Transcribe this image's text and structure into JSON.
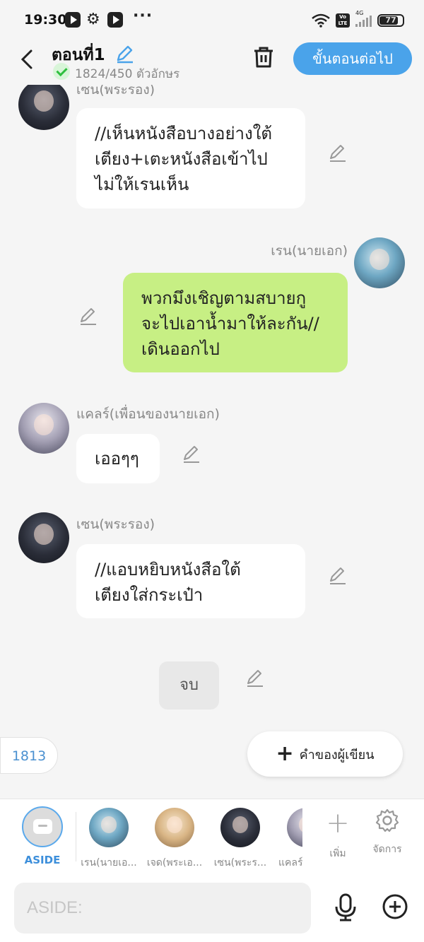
{
  "status_bar": {
    "time": "19:30",
    "volte": "Vo LTE",
    "network": "4G",
    "battery": "77",
    "battery_level": 0.77
  },
  "header": {
    "title": "ตอนที่1",
    "char_count": "1824/450 ตัวอักษร",
    "next_button": "ขั้นตอนต่อไป"
  },
  "messages": [
    {
      "name": "เซน(พระรอง)",
      "lines": [
        "//เห็นหนังสือบางอย่างใต้",
        "เตียง+เตะหนังสือเข้าไป",
        "ไม่ให้เรนเห็น"
      ],
      "side": "left",
      "avatar": "dark"
    },
    {
      "name": "เรน(นายเอก)",
      "lines": [
        "พวกมึงเชิญตามสบายกู",
        "จะไปเอาน้ำมาให้ละกัน//",
        "เดินออกไป"
      ],
      "side": "right",
      "avatar": "blue"
    },
    {
      "name": "แคลร์(เพื่อนของนายเอก)",
      "lines": [
        "เออๆๆ"
      ],
      "side": "left",
      "avatar": "gray"
    },
    {
      "name": "เซน(พระรอง)",
      "lines": [
        "//แอบหยิบหนังสือใต้",
        "เตียงใส่กระเป๋า"
      ],
      "side": "left",
      "avatar": "dark"
    }
  ],
  "end_marker": "จบ",
  "counter": "1813",
  "author_note_button": "คำของผู้เขียน",
  "character_bar": {
    "aside_label": "ASIDE",
    "characters": [
      {
        "label": "เรน(นายเอ...",
        "avatar": "blue"
      },
      {
        "label": "เจด(พระเอ...",
        "avatar": "gold"
      },
      {
        "label": "เซน(พระร...",
        "avatar": "dark"
      },
      {
        "label": "แคลร์",
        "avatar": "gray"
      }
    ],
    "add_label": "เพิ่ม",
    "manage_label": "จัดการ"
  },
  "input": {
    "placeholder": "ASIDE:",
    "value": ""
  },
  "colors": {
    "accent": "#4aa3ea",
    "my_bubble": "#c7ef84",
    "other_bubble": "#ffffff",
    "background": "#f5f5f5"
  }
}
